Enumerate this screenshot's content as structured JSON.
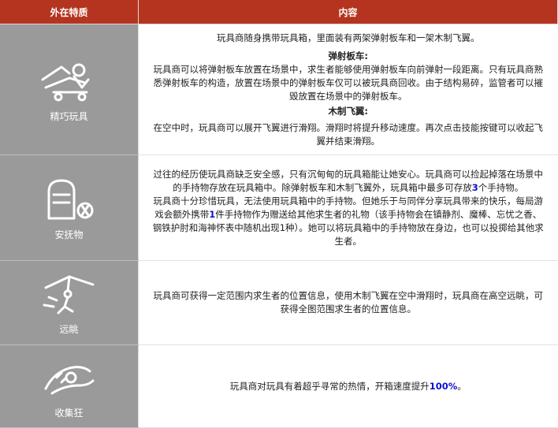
{
  "header": {
    "col_trait": "外在特质",
    "col_content": "内容"
  },
  "rows": [
    {
      "name": "精巧玩具",
      "icon": "toy-glider-icon",
      "intro": "玩具商随身携带玩具箱，里面装有两架弹射板车和一架木制飞翼。",
      "sub1_title": "弹射板车:",
      "sub1_text": "玩具商可以将弹射板车放置在场景中，求生者能够使用弹射板车向前弹射一段距离。只有玩具商熟悉弹射板车的构造，放置在场景中的弹射板车仅可以被玩具商回收。由于结构易碎，监管者可以摧毁放置在场景中的弹射板车。",
      "sub2_title": "木制飞翼:",
      "sub2_text": "在空中时，玩具商可以展开飞翼进行滑翔。滑翔时将提升移动速度。再次点击技能按键可以收起飞翼并结束滑翔。"
    },
    {
      "name": "安抚物",
      "icon": "toy-box-icon",
      "p1_a": "过往的经历使玩具商缺乏安全感，只有沉甸甸的玩具箱能让她安心。玩具商可以捡起掉落在场景中的手持物存放在玩具箱中。除弹射板车和木制飞翼外，玩具箱中最多可存放",
      "p1_num": "3",
      "p1_b": "个手持物。",
      "p2_a": "玩具商十分珍惜玩具，无法使用玩具箱中的手持物。但她乐于与同伴分享玩具带来的快乐，每局游戏会额外携带",
      "p2_num": "1",
      "p2_b": "件手持物作为赠送给其他求生者的礼物（该手持物会在镇静剂、魔棒、忘忧之香、钢铁护肘和海神怀表中随机出现1种）。她可以将玩具箱中的手持物放在身边，也可以投掷给其他求生者。"
    },
    {
      "name": "远眺",
      "icon": "gliding-figure-icon",
      "text": "玩具商可获得一定范围内求生者的位置信息，使用木制飞翼在空中滑翔时，玩具商在高空远眺，可获得全图范围求生者的位置信息。"
    },
    {
      "name": "收集狂",
      "icon": "hands-holding-icon",
      "text_a": "玩具商对玩具有着超乎寻常的热情，开箱速度提升",
      "text_num": "100%",
      "text_b": "。"
    }
  ]
}
